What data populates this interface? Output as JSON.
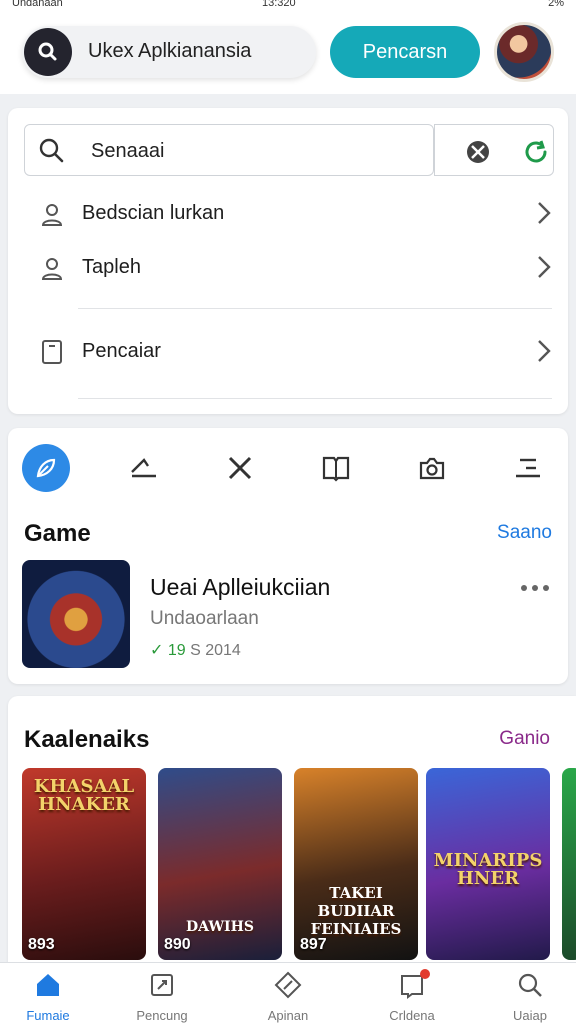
{
  "status_bar": {
    "left": "Undanaan",
    "center": "13:320",
    "right": "2%"
  },
  "header": {
    "search_pill_text": "Ukex Aplkianansia",
    "primary_button": "Pencarsn",
    "avatar_icon": "avatar-icon"
  },
  "search_card": {
    "search_placeholder": "Senaaai",
    "tools": [
      "magic-icon",
      "refresh-icon"
    ],
    "items": [
      {
        "label": "Bedscian lurkan",
        "icon": "person-icon"
      },
      {
        "label": "Tapleh",
        "icon": "person-icon"
      },
      {
        "label": "Pencaiar",
        "icon": "tablet-icon"
      }
    ]
  },
  "featured": {
    "category_icons": [
      "feather-icon",
      "arrow-icon",
      "tools-icon",
      "book-icon",
      "camera-icon",
      "menu-icon"
    ],
    "section_title": "Game",
    "section_link": "Saano",
    "app": {
      "title": "Ueai Aplleiukciian",
      "subtitle": "Undaoarlaan",
      "rating": "19",
      "meta": "S 2014"
    }
  },
  "categories": {
    "section_title": "Kaalenaiks",
    "section_link": "Ganio",
    "link_color": "#8a2a8a",
    "tiles": [
      {
        "title": "KHASAAL HNAKER",
        "caption": "893"
      },
      {
        "title": "",
        "caption": "890",
        "sub": "DAWIHS"
      },
      {
        "title": "TAKEI BUDIIAR FEINIAIES",
        "caption": "897"
      },
      {
        "title": "MINARIPS HNER",
        "caption": ""
      },
      {
        "title": "",
        "caption": ""
      }
    ]
  },
  "bottom_nav": [
    {
      "label": "Fumaie",
      "icon": "home-icon",
      "active": true
    },
    {
      "label": "Pencung",
      "icon": "frame-icon",
      "active": false
    },
    {
      "label": "Apinan",
      "icon": "diamond-icon",
      "active": false
    },
    {
      "label": "Crldena",
      "icon": "book-icon",
      "active": false
    },
    {
      "label": "Uaiap",
      "icon": "search-icon",
      "active": false
    }
  ],
  "colors": {
    "accent": "#15a9b8",
    "link": "#1f7ae0",
    "active": "#2d8ae6"
  }
}
